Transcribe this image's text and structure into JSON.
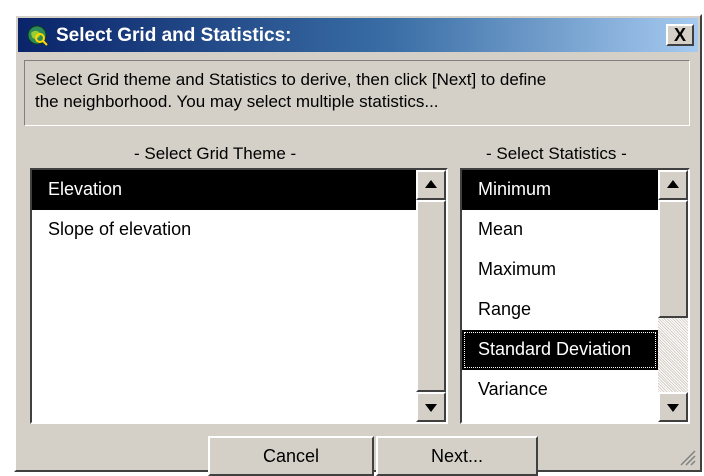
{
  "window": {
    "title": "Select Grid and Statistics:",
    "close_label": "X"
  },
  "instructions": {
    "line1": "Select Grid theme and Statistics to derive, then click [Next] to define",
    "line2": "the neighborhood.  You may select multiple statistics..."
  },
  "grid_theme": {
    "label": "- Select Grid Theme -",
    "items": [
      {
        "label": "Elevation",
        "selected": true
      },
      {
        "label": "Slope of elevation",
        "selected": false
      }
    ]
  },
  "statistics": {
    "label": "- Select Statistics -",
    "items": [
      {
        "label": "Minimum",
        "selected": true
      },
      {
        "label": "Mean",
        "selected": false
      },
      {
        "label": "Maximum",
        "selected": false
      },
      {
        "label": "Range",
        "selected": false
      },
      {
        "label": "Standard Deviation",
        "selected": true,
        "focused": true
      },
      {
        "label": "Variance",
        "selected": false
      }
    ]
  },
  "buttons": {
    "cancel": "Cancel",
    "next": "Next..."
  },
  "icons": {
    "app": "globe-icon",
    "close": "close-icon",
    "scroll_up": "arrow-up-icon",
    "scroll_down": "arrow-down-icon",
    "resize": "resize-grip-icon"
  },
  "colors": {
    "title_start": "#0a246a",
    "title_end": "#a6caf0",
    "face": "#d4d0c8",
    "selection": "#000000"
  }
}
